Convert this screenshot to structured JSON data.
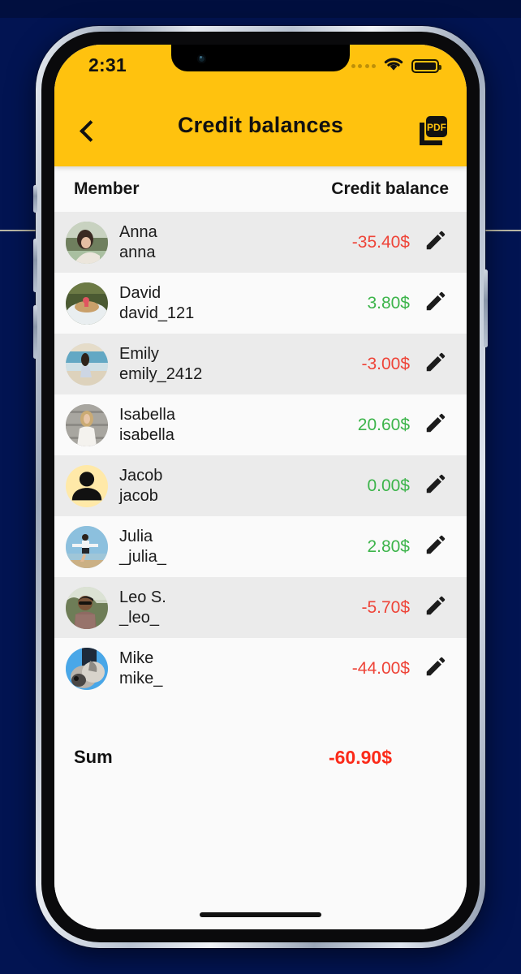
{
  "status_bar": {
    "time": "2:31",
    "signal_icon": "signal-dots-icon",
    "wifi_icon": "wifi-icon",
    "battery_icon": "battery-full-icon"
  },
  "app_bar": {
    "back_icon": "chevron-left-icon",
    "title": "Credit balances",
    "pdf_icon": "pdf-export-icon",
    "background_color": "#FFC20E"
  },
  "table": {
    "columns": {
      "member": "Member",
      "balance": "Credit balance"
    },
    "rows": [
      {
        "name": "Anna",
        "username": "anna",
        "amount": "-35.40$",
        "sign": "neg",
        "avatar": "photo-woman-field",
        "edit_icon": "pencil-icon"
      },
      {
        "name": "David",
        "username": "david_121",
        "amount": "3.80$",
        "sign": "pos",
        "avatar": "photo-man-boat",
        "edit_icon": "pencil-icon"
      },
      {
        "name": "Emily",
        "username": "emily_2412",
        "amount": "-3.00$",
        "sign": "neg",
        "avatar": "photo-woman-beach",
        "edit_icon": "pencil-icon"
      },
      {
        "name": "Isabella",
        "username": "isabella",
        "amount": "20.60$",
        "sign": "pos",
        "avatar": "photo-woman-wall",
        "edit_icon": "pencil-icon"
      },
      {
        "name": "Jacob",
        "username": "jacob",
        "amount": "0.00$",
        "sign": "pos",
        "avatar": "placeholder-person",
        "edit_icon": "pencil-icon"
      },
      {
        "name": "Julia",
        "username": "_julia_",
        "amount": "2.80$",
        "sign": "pos",
        "avatar": "photo-woman-jump",
        "edit_icon": "pencil-icon"
      },
      {
        "name": "Leo S.",
        "username": "_leo_",
        "amount": "-5.70$",
        "sign": "neg",
        "avatar": "photo-man-hat",
        "edit_icon": "pencil-icon"
      },
      {
        "name": "Mike",
        "username": "mike_",
        "amount": "-44.00$",
        "sign": "neg",
        "avatar": "photo-man-dog",
        "edit_icon": "pencil-icon"
      }
    ],
    "sum": {
      "label": "Sum",
      "value": "-60.90$"
    }
  },
  "colors": {
    "accent_yellow": "#FFC20E",
    "negative": "#EE4438",
    "positive": "#3CB44A",
    "sum_negative": "#FB2A19",
    "row_odd": "#EBEBEB",
    "row_even": "#FAFAFA",
    "backdrop": "#021452"
  }
}
